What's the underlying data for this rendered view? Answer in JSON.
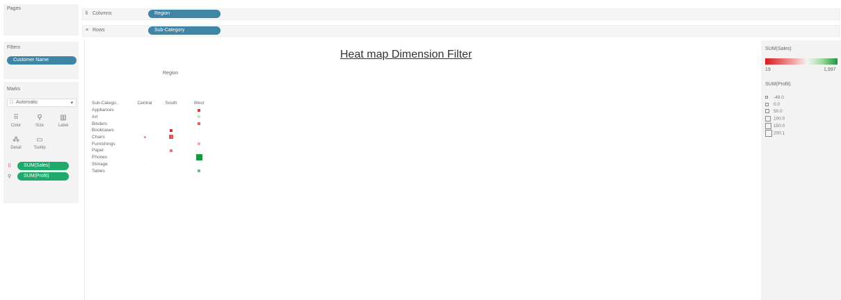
{
  "shelves": {
    "pages_label": "Pages",
    "columns_icon": "columns-icon",
    "columns_label": "Columns",
    "columns_pill": "Region",
    "rows_icon": "rows-icon",
    "rows_label": "Rows",
    "rows_pill": "Sub-Category"
  },
  "filters": {
    "title": "Filters",
    "pill": "Customer Name"
  },
  "marks": {
    "title": "Marks",
    "mark_type": "Automatic",
    "buttons": [
      {
        "label": "Color",
        "icon": "color-icon",
        "glyph": "⠿"
      },
      {
        "label": "Size",
        "icon": "size-icon",
        "glyph": "⚲"
      },
      {
        "label": "Label",
        "icon": "label-icon",
        "glyph": "▥"
      },
      {
        "label": "Detail",
        "icon": "detail-icon",
        "glyph": "⁂"
      },
      {
        "label": "Tooltip",
        "icon": "tooltip-icon",
        "glyph": "▭"
      }
    ],
    "fields": [
      {
        "label": "SUM(Sales)",
        "icon": "color-encoding-icon"
      },
      {
        "label": "SUM(Profit)",
        "icon": "size-encoding-icon"
      }
    ]
  },
  "view": {
    "title": "Heat map Dimension Filter",
    "row_header": "Sub-Catego..",
    "column_group": "Region",
    "columns": [
      "Central",
      "South",
      "West"
    ],
    "rows": [
      "Appliances",
      "Art",
      "Binders",
      "Bookcases",
      "Chairs",
      "Furnishings",
      "Paper",
      "Phones",
      "Storage",
      "Tables"
    ]
  },
  "chart_data": {
    "type": "heatmap",
    "title": "Heat map Dimension Filter",
    "x_field": "Region",
    "y_field": "Sub-Category",
    "columns": [
      "Central",
      "South",
      "West"
    ],
    "rows": [
      "Appliances",
      "Art",
      "Binders",
      "Bookcases",
      "Chairs",
      "Furnishings",
      "Paper",
      "Phones",
      "Storage",
      "Tables"
    ],
    "color_measure": "SUM(Sales)",
    "size_measure": "SUM(Profit)",
    "color_range": [
      19,
      1997
    ],
    "colors": {
      "low": "#d7191c",
      "mid": "#f4f4f4",
      "high": "#1a9641"
    },
    "cells": [
      {
        "row": "Appliances",
        "col": "West",
        "sales": 180,
        "profit": 40
      },
      {
        "row": "Art",
        "col": "West",
        "sales": 1200,
        "profit": 40
      },
      {
        "row": "Binders",
        "col": "West",
        "sales": 350,
        "profit": 40
      },
      {
        "row": "Bookcases",
        "col": "South",
        "sales": 120,
        "profit": 40
      },
      {
        "row": "Chairs",
        "col": "Central",
        "sales": 600,
        "profit": 20
      },
      {
        "row": "Chairs",
        "col": "South",
        "sales": 300,
        "profit": 80
      },
      {
        "row": "Furnishings",
        "col": "West",
        "sales": 700,
        "profit": 40
      },
      {
        "row": "Paper",
        "col": "South",
        "sales": 450,
        "profit": 40
      },
      {
        "row": "Phones",
        "col": "West",
        "sales": 1997,
        "profit": 150
      },
      {
        "row": "Storage",
        "col": "Central",
        "sales": 1000,
        "profit": 10
      },
      {
        "row": "Tables",
        "col": "West",
        "sales": 1600,
        "profit": 40
      }
    ]
  },
  "legends": {
    "sales": {
      "title": "SUM(Sales)",
      "min": "19",
      "max": "1,997"
    },
    "profit": {
      "title": "SUM(Profit)",
      "items": [
        "-49.0",
        "0.0",
        "50.0",
        "100.0",
        "150.0",
        "200.1"
      ]
    }
  }
}
